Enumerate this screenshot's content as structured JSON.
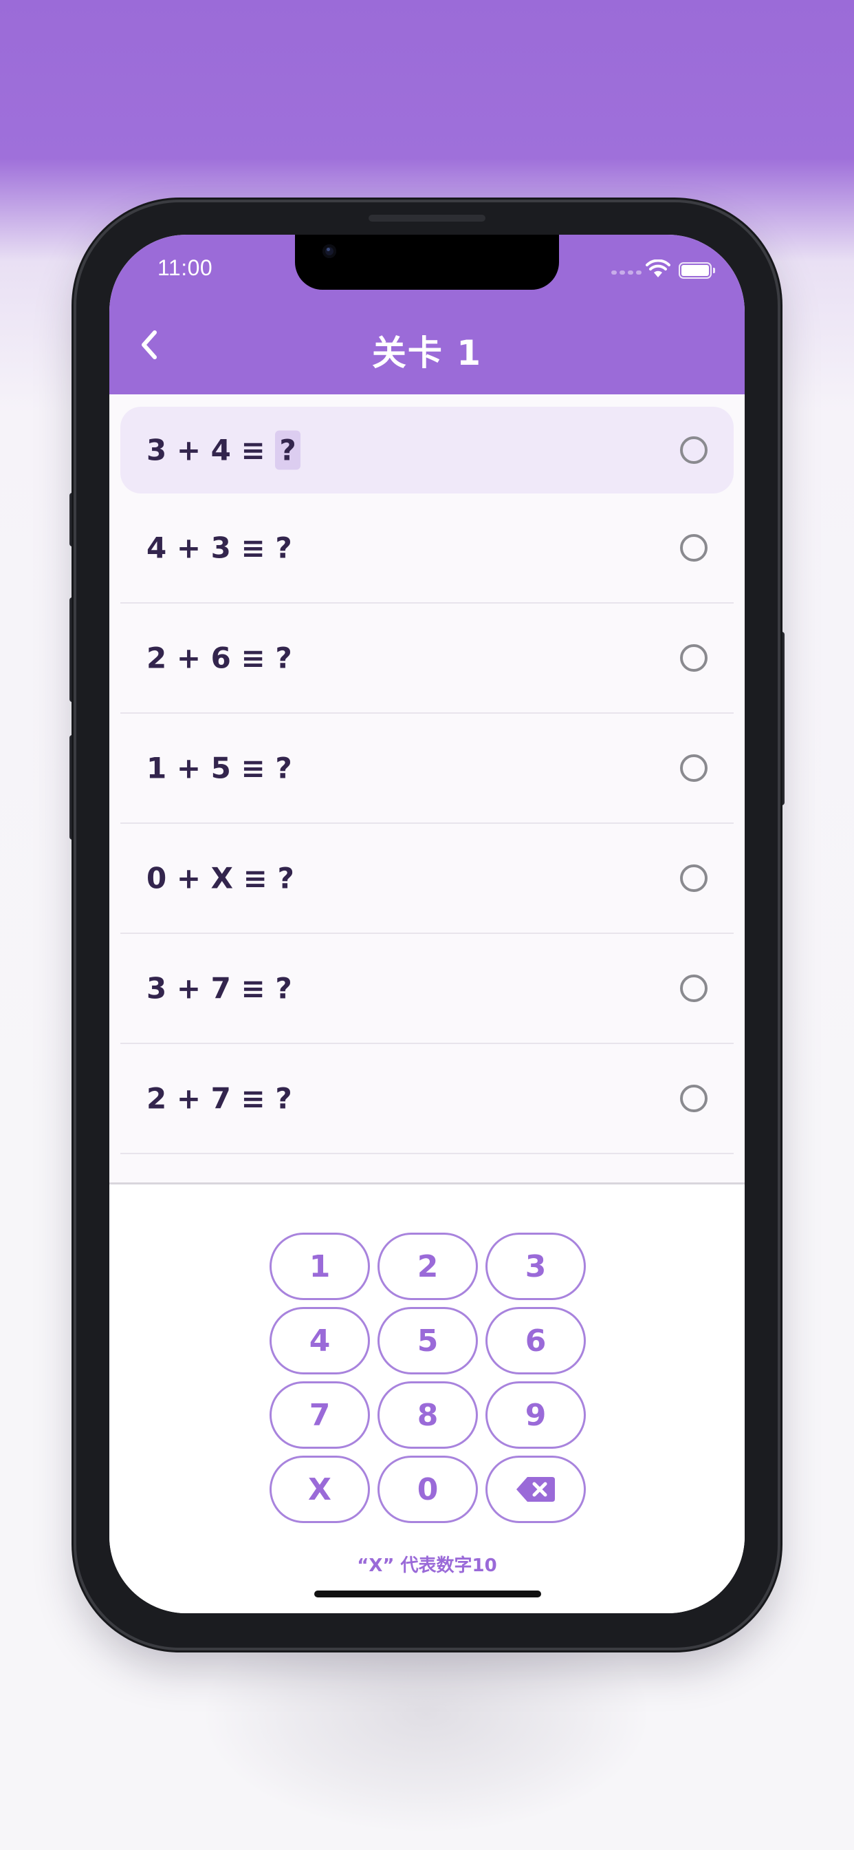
{
  "status_bar": {
    "time": "11:00"
  },
  "header": {
    "title": "关卡 1"
  },
  "questions": [
    {
      "expression": "3 + 4 ≡ ",
      "answer": "?"
    },
    {
      "expression": "4 + 3 ≡ ",
      "answer": "?"
    },
    {
      "expression": "2 + 6 ≡ ",
      "answer": "?"
    },
    {
      "expression": "1 + 5 ≡ ",
      "answer": "?"
    },
    {
      "expression": "0 + X ≡ ",
      "answer": "?"
    },
    {
      "expression": "3 + 7 ≡ ",
      "answer": "?"
    },
    {
      "expression": "2 + 7 ≡ ",
      "answer": "?"
    }
  ],
  "keypad": {
    "keys": [
      "1",
      "2",
      "3",
      "4",
      "5",
      "6",
      "7",
      "8",
      "9",
      "X",
      "0"
    ],
    "delete_icon": "backspace-icon"
  },
  "hint": "“X” 代表数字10",
  "colors": {
    "accent": "#9b6bd8",
    "text": "#33254d",
    "active_row": "#f0e9f9"
  }
}
